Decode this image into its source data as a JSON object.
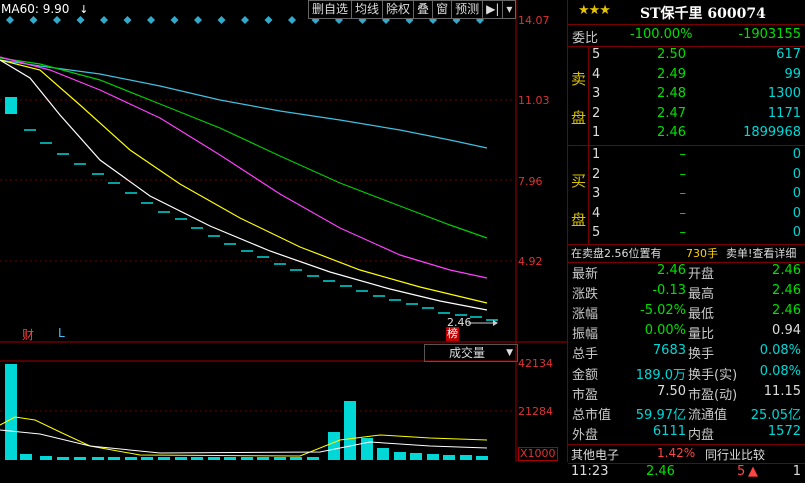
{
  "chart": {
    "ma_label": "MA60: 9.90",
    "toolbar": [
      "删自选",
      "均线",
      "除权",
      "叠",
      "窗",
      "预测",
      "▶|"
    ],
    "y_labels": [
      "14.07",
      "11.03",
      "7.96",
      "4.92"
    ],
    "current_price_tag": "2.46",
    "marker_cai": "财",
    "marker_L": "L",
    "marker_bang": "榜",
    "volume_label": "成交量",
    "vol_y_labels": [
      "42134",
      "21284",
      "X1000"
    ],
    "colors": {
      "ma_white": "#ffffff",
      "ma_yellow": "#ffff00",
      "ma_magenta": "#ff40ff",
      "ma_green": "#00cc00",
      "ma_cyan": "#40c0e0",
      "candle": "#00d8d8"
    }
  },
  "panel": {
    "stars": "★★★",
    "title": "ST保千里 600074",
    "weibi": {
      "label": "委比",
      "pct": "-100.00%",
      "value": "-1903155"
    },
    "sell_label": "卖盘",
    "buy_label": "买盘",
    "sell": [
      {
        "n": "5",
        "price": "2.50",
        "vol": "617"
      },
      {
        "n": "4",
        "price": "2.49",
        "vol": "99"
      },
      {
        "n": "3",
        "price": "2.48",
        "vol": "1300"
      },
      {
        "n": "2",
        "price": "2.47",
        "vol": "1171"
      },
      {
        "n": "1",
        "price": "2.46",
        "vol": "1899968"
      }
    ],
    "buy": [
      {
        "n": "1",
        "price": "–",
        "vol": "0"
      },
      {
        "n": "2",
        "price": "–",
        "vol": "0"
      },
      {
        "n": "3",
        "price": "–",
        "vol": "0"
      },
      {
        "n": "4",
        "price": "–",
        "vol": "0"
      },
      {
        "n": "5",
        "price": "–",
        "vol": "0"
      }
    ],
    "pending": {
      "text": "在卖盘2.56位置有",
      "vol": "730手",
      "link": "卖单!查看详细"
    },
    "stats": [
      {
        "l1": "最新",
        "v1": "2.46",
        "l2": "开盘",
        "v2": "2.46"
      },
      {
        "l1": "涨跌",
        "v1": "-0.13",
        "l2": "最高",
        "v2": "2.46"
      },
      {
        "l1": "涨幅",
        "v1": "-5.02%",
        "l2": "最低",
        "v2": "2.46"
      },
      {
        "l1": "振幅",
        "v1": "0.00%",
        "l2": "量比",
        "v2": "0.94"
      },
      {
        "l1": "总手",
        "v1": "7683",
        "l2": "换手",
        "v2": "0.08%"
      },
      {
        "l1": "金额",
        "v1": "189.0万",
        "l2": "换手(实)",
        "v2": "0.08%"
      },
      {
        "l1": "市盈",
        "v1": "7.50",
        "l2": "市盈(动)",
        "v2": "11.15"
      },
      {
        "l1": "总市值",
        "v1": "59.97亿",
        "l2": "流通值",
        "v2": "25.05亿"
      },
      {
        "l1": "外盘",
        "v1": "6111",
        "l2": "内盘",
        "v2": "1572"
      }
    ],
    "industry": {
      "name": "其他电子",
      "pct": "1.42%",
      "compare": "同行业比较"
    },
    "tick": {
      "time": "11:23",
      "price": "2.46",
      "vol": "5",
      "count": "1"
    }
  }
}
